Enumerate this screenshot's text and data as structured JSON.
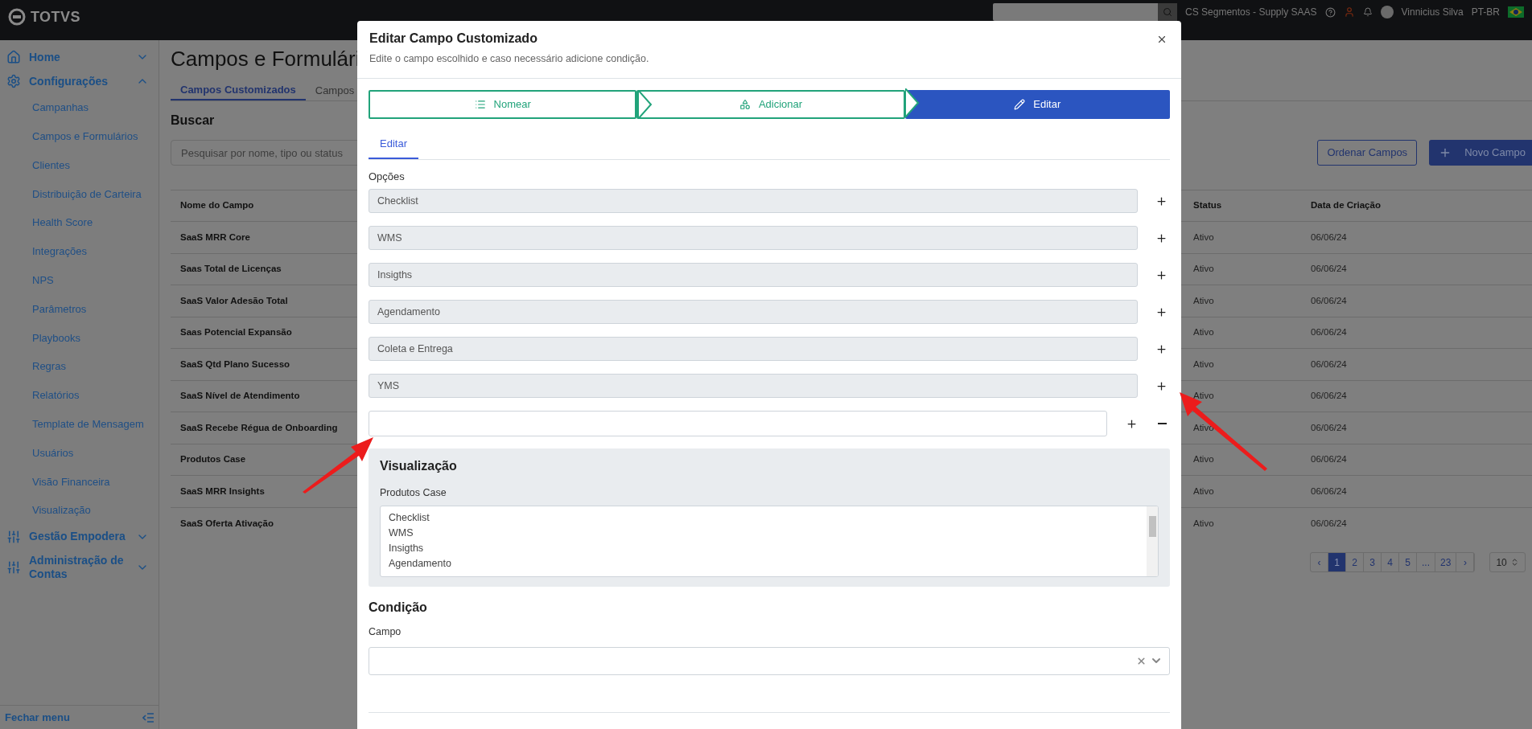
{
  "top_bar": {
    "logo": "TOTVS",
    "account": "CS Segmentos - Supply SAAS",
    "user": "Vinnicius Silva",
    "language": "PT-BR"
  },
  "sidebar": {
    "sections": [
      {
        "label": "Home",
        "expanded": false
      },
      {
        "label": "Configurações",
        "expanded": true,
        "children": [
          "Campanhas",
          "Campos e Formulários",
          "Clientes",
          "Distribuição de Carteira",
          "Health Score",
          "Integrações",
          "NPS",
          "Parâmetros",
          "Playbooks",
          "Regras",
          "Relatórios",
          "Template de Mensagem",
          "Usuários",
          "Visão Financeira",
          "Visualização"
        ]
      },
      {
        "label": "Gestão Empodera",
        "expanded": false
      },
      {
        "label": "Administração de Contas",
        "expanded": false
      }
    ],
    "collapse": "Fechar menu"
  },
  "page": {
    "title": "Campos e Formulári",
    "tabs": [
      {
        "label": "Campos Customizados",
        "selected": true
      },
      {
        "label": "Campos",
        "selected": false
      }
    ],
    "search_label": "Buscar",
    "search": {
      "placeholder": "Pesquisar por nome, tipo ou status"
    },
    "buttons": [
      "Ordenar Campos",
      "Novo Campo"
    ],
    "table": {
      "columns": [
        "Nome do Campo",
        "Status",
        "Data de Criação"
      ],
      "rows": [
        {
          "name": "SaaS MRR Core",
          "status": "Ativo",
          "date": "06/06/24"
        },
        {
          "name": "Saas Total de Licenças",
          "status": "Ativo",
          "date": "06/06/24"
        },
        {
          "name": "SaaS Valor Adesão Total",
          "status": "Ativo",
          "date": "06/06/24"
        },
        {
          "name": "Saas Potencial Expansão",
          "status": "Ativo",
          "date": "06/06/24"
        },
        {
          "name": "SaaS Qtd Plano Sucesso",
          "status": "Ativo",
          "date": "06/06/24"
        },
        {
          "name": "SaaS Nível de Atendimento",
          "status": "Ativo",
          "date": "06/06/24"
        },
        {
          "name": "SaaS Recebe Régua de Onboarding",
          "status": "Ativo",
          "date": "06/06/24"
        },
        {
          "name": "Produtos Case",
          "status": "Ativo",
          "date": "06/06/24"
        },
        {
          "name": "SaaS MRR Insights",
          "status": "Ativo",
          "date": "06/06/24"
        },
        {
          "name": "SaaS Oferta Ativação",
          "status": "Ativo",
          "date": "06/06/24"
        }
      ]
    },
    "pagination": [
      {
        "label": "‹",
        "selected": false
      },
      {
        "label": "1",
        "selected": true
      },
      {
        "label": "2",
        "selected": false
      },
      {
        "label": "3",
        "selected": false
      },
      {
        "label": "4",
        "selected": false
      },
      {
        "label": "5",
        "selected": false
      },
      {
        "label": "...",
        "selected": false
      },
      {
        "label": "23",
        "selected": false
      },
      {
        "label": "›",
        "selected": false
      }
    ],
    "page_size": "10"
  },
  "modal": {
    "title": "Editar Campo Customizado",
    "subtitle": "Edite o campo escolhido e caso necessário adicione condição.",
    "steps": [
      {
        "label": "Nomear",
        "selected": false
      },
      {
        "label": "Adicionar",
        "selected": false
      },
      {
        "label": "Editar",
        "selected": true
      }
    ],
    "tabs": [
      {
        "label": "Editar",
        "selected": true
      }
    ],
    "options_label": "Opções",
    "options": [
      "Checklist",
      "WMS",
      "Insigths",
      "Agendamento",
      "Coleta e Entrega",
      "YMS"
    ],
    "preview": {
      "title": "Visualização",
      "field_label": "Produtos Case",
      "items": [
        "Checklist",
        "WMS",
        "Insigths",
        "Agendamento"
      ]
    },
    "condition": {
      "title": "Condição",
      "field_label": "Campo"
    }
  }
}
